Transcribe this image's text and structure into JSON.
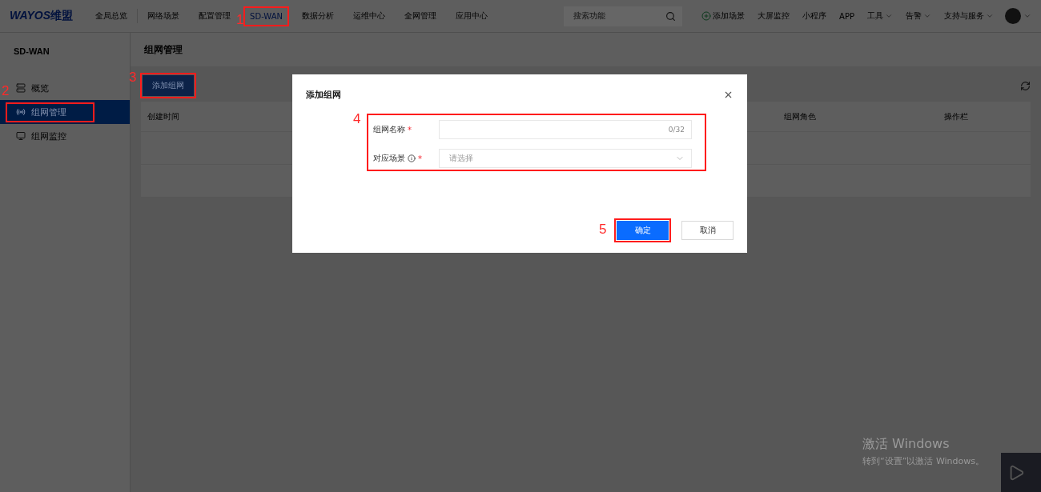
{
  "topbar": {
    "logo": "WAYOS",
    "logo_suffix": "维盟",
    "nav": [
      {
        "label": "全局总览",
        "selected": false
      },
      {
        "label": "网络场景",
        "selected": false
      },
      {
        "label": "配置管理",
        "selected": false
      },
      {
        "label": "SD-WAN",
        "selected": true,
        "marker": "1"
      },
      {
        "label": "数据分析",
        "selected": false
      },
      {
        "label": "运维中心",
        "selected": false
      },
      {
        "label": "全网管理",
        "selected": false
      },
      {
        "label": "应用中心",
        "selected": false
      }
    ],
    "search": {
      "placeholder": "搜索功能"
    },
    "actions": [
      {
        "label": "添加场景",
        "kind": "add"
      },
      {
        "label": "大屏监控",
        "kind": "link"
      },
      {
        "label": "小程序",
        "kind": "link"
      },
      {
        "label": "APP",
        "kind": "link"
      },
      {
        "label": "工具",
        "kind": "menu"
      },
      {
        "label": "告警",
        "kind": "menu"
      },
      {
        "label": "支持与服务",
        "kind": "menu"
      }
    ]
  },
  "sidebar": {
    "title": "SD-WAN",
    "items": [
      {
        "label": "概览",
        "selected": false
      },
      {
        "label": "组网管理",
        "selected": true,
        "marker": "2"
      },
      {
        "label": "组网监控",
        "selected": false
      }
    ]
  },
  "main": {
    "title": "组网管理",
    "add_button": {
      "label": "添加组网",
      "marker": "3"
    },
    "table": {
      "columns": [
        "创建时间",
        "组网角色",
        "操作栏"
      ]
    }
  },
  "dialog": {
    "title": "添加组网",
    "form_marker": "4",
    "fields": [
      {
        "label": "组网名称",
        "kind": "text",
        "required": true,
        "info": false,
        "counter": "0/32"
      },
      {
        "label": "对应场景",
        "kind": "select",
        "required": true,
        "info": true,
        "placeholder": "请选择"
      }
    ],
    "required_mark": "*",
    "buttons": [
      {
        "label": "确定",
        "primary": true,
        "marker": "5"
      },
      {
        "label": "取消",
        "primary": false
      }
    ]
  },
  "os_notice": {
    "title": "激活 Windows",
    "text": "转到“设置”以激活 Windows。"
  }
}
